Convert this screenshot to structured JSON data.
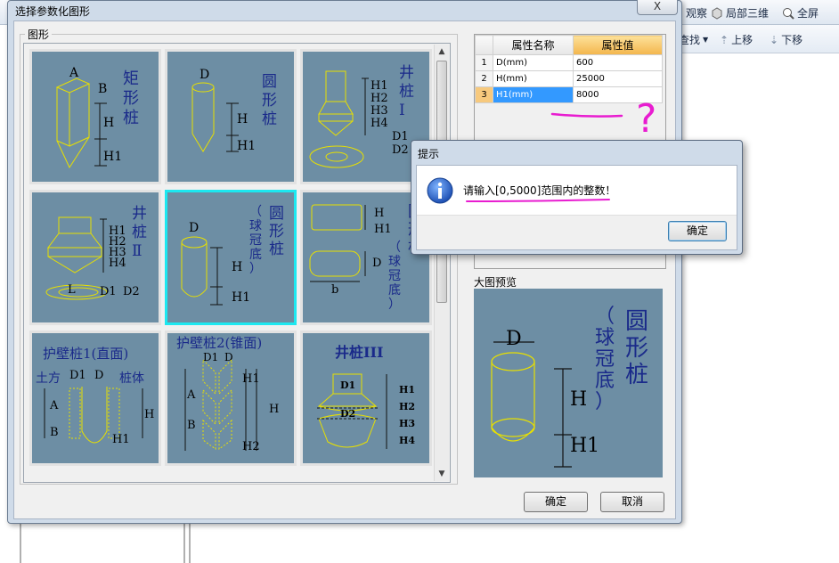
{
  "background_toolbar": {
    "items": [
      "观察",
      "局部三维",
      "全屏"
    ],
    "items2": [
      "查找",
      "上移",
      "下移"
    ]
  },
  "dialog": {
    "title": "选择参数化图形",
    "close_label": "X",
    "shape_group_label": "图形",
    "tiles": [
      {
        "label_v": [
          "矩",
          "形",
          "桩"
        ],
        "dims": [
          "A",
          "B",
          "H",
          "H1"
        ]
      },
      {
        "label_v": [
          "圆",
          "形",
          "桩"
        ],
        "dims": [
          "D",
          "H",
          "H1"
        ]
      },
      {
        "label_v": [
          "井",
          "桩",
          "Ⅰ"
        ],
        "dims": [
          "H1",
          "H2",
          "H3",
          "H4",
          "D1",
          "D2"
        ]
      },
      {
        "label_v": [
          "井",
          "桩",
          "Ⅱ"
        ],
        "dims": [
          "H1",
          "H2",
          "H3",
          "H4",
          "L",
          "D1",
          "D2"
        ]
      },
      {
        "label_v": [
          "圆",
          "形",
          "桩"
        ],
        "label_v2": [
          "（",
          "球",
          "冠",
          "底",
          "）"
        ],
        "dims": [
          "D",
          "H",
          "H1"
        ]
      },
      {
        "label_v": [
          "圆",
          "形",
          "桩"
        ],
        "label_v2": [
          "（",
          "球",
          "冠",
          "底",
          "）"
        ],
        "dims": [
          "H",
          "H1",
          "D",
          "b"
        ]
      },
      {
        "label": "护壁桩1(直面)",
        "sub": [
          "土方",
          "D1",
          "D",
          "桩体"
        ],
        "dims": [
          "A",
          "B",
          "H",
          "H1"
        ]
      },
      {
        "label": "护壁桩2(锥面)",
        "sub": [
          "D1",
          "D"
        ],
        "dims": [
          "A",
          "B",
          "H1",
          "H",
          "H2"
        ]
      },
      {
        "label": "井桩III",
        "dims": [
          "D1",
          "D2",
          "H1",
          "H2",
          "H3",
          "H4"
        ]
      }
    ],
    "property_grid": {
      "headers": [
        "属性名称",
        "属性值"
      ],
      "rows": [
        {
          "num": "1",
          "name": "D(mm)",
          "value": "600"
        },
        {
          "num": "2",
          "name": "H(mm)",
          "value": "25000"
        },
        {
          "num": "3",
          "name": "H1(mm)",
          "value": "8000"
        }
      ]
    },
    "preview": {
      "label": "大图预览",
      "title_v": [
        "圆",
        "形",
        "桩"
      ],
      "title_v2": [
        "（",
        "球",
        "冠",
        "底",
        "）"
      ],
      "dims": [
        "D",
        "H",
        "H1"
      ]
    },
    "ok_label": "确定",
    "cancel_label": "取消"
  },
  "message_box": {
    "title": "提示",
    "text": "请输入[0,5000]范围内的整数！",
    "ok_label": "确定"
  },
  "annotation": {
    "mark": "?",
    "color": "#e81cd0"
  }
}
